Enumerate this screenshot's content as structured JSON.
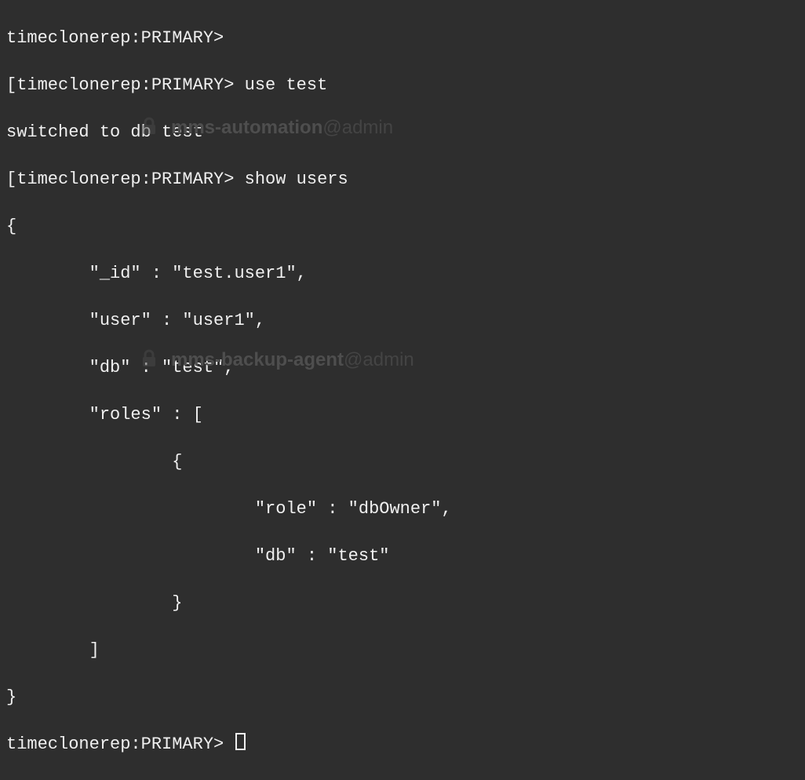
{
  "colors": {
    "bg": "#2e2e2e",
    "fg": "#f0f0f0",
    "watermark": "#4e4e4e"
  },
  "lines": {
    "l0": "timeclonerep:PRIMARY>",
    "l1": "[timeclonerep:PRIMARY> use test",
    "l2": "switched to db test",
    "l3": "[timeclonerep:PRIMARY> show users",
    "l4": "{",
    "l5": "        \"_id\" : \"test.user1\",",
    "l6": "        \"user\" : \"user1\",",
    "l7": "        \"db\" : \"test\",",
    "l8": "        \"roles\" : [",
    "l9": "                {",
    "l10": "                        \"role\" : \"dbOwner\",",
    "l11": "                        \"db\" : \"test\"",
    "l12": "                }",
    "l13": "        ]",
    "l14": "}",
    "l15": "timeclonerep:PRIMARY> "
  },
  "watermarks": {
    "wm1_user": "mms-automation",
    "wm1_at": "@admin",
    "wm2_user": "mms-backup-agent",
    "wm2_at": "@admin"
  }
}
